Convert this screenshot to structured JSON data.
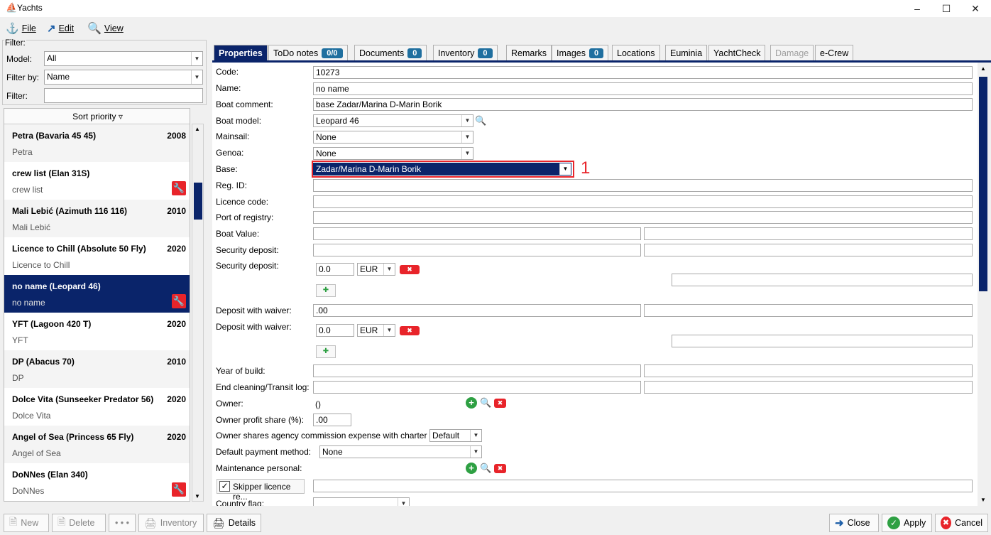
{
  "window": {
    "title": "Yachts"
  },
  "menu": {
    "file": "File",
    "edit": "Edit",
    "view": "View"
  },
  "filter": {
    "legend": "Filter:",
    "model_label": "Model:",
    "model_value": "All",
    "filterby_label": "Filter by:",
    "filterby_value": "Name",
    "filter_label": "Filter:",
    "filter_value": ""
  },
  "list": {
    "sort_header": "Sort priority ▿",
    "items": [
      {
        "name": "Petra (Bavaria 45 45)",
        "year": "2008",
        "sub": "Petra",
        "warn": false
      },
      {
        "name": "crew list (Elan 31S)",
        "year": "",
        "sub": "crew list",
        "warn": true
      },
      {
        "name": "Mali Lebić (Azimuth 116 116)",
        "year": "2010",
        "sub": "Mali Lebić",
        "warn": false
      },
      {
        "name": "Licence to Chill (Absolute 50 Fly)",
        "year": "2020",
        "sub": "Licence to Chill",
        "warn": false
      },
      {
        "name": "no name (Leopard 46)",
        "year": "",
        "sub": "no name",
        "warn": true,
        "selected": true
      },
      {
        "name": "YFT (Lagoon 420 T)",
        "year": "2020",
        "sub": "YFT",
        "warn": false
      },
      {
        "name": "DP (Abacus 70)",
        "year": "2010",
        "sub": "DP",
        "warn": false
      },
      {
        "name": "Dolce Vita (Sunseeker Predator 56)",
        "year": "2020",
        "sub": "Dolce Vita",
        "warn": false
      },
      {
        "name": "Angel of Sea (Princess 65 Fly)",
        "year": "2020",
        "sub": "Angel of Sea",
        "warn": false
      },
      {
        "name": "DoNNes (Elan 340)",
        "year": "",
        "sub": "DoNNes",
        "warn": true
      }
    ]
  },
  "tabs": [
    {
      "label": "Properties",
      "badge": "",
      "state": "active"
    },
    {
      "label": "ToDo notes",
      "badge": "0/0"
    },
    {
      "label": "Documents",
      "badge": "0"
    },
    {
      "label": "Inventory",
      "badge": "0"
    },
    {
      "label": "Remarks",
      "badge": ""
    },
    {
      "label": "Images",
      "badge": "0"
    },
    {
      "label": "Locations",
      "badge": ""
    },
    {
      "label": "Euminia",
      "badge": ""
    },
    {
      "label": "YachtCheck",
      "badge": ""
    },
    {
      "label": "Damage",
      "badge": "",
      "state": "disabled"
    },
    {
      "label": "e-Crew",
      "badge": ""
    }
  ],
  "form": {
    "code_label": "Code:",
    "code_value": "10273",
    "name_label": "Name:",
    "name_value": "no name",
    "comment_label": "Boat comment:",
    "comment_value": "base Zadar/Marina D-Marin Borik",
    "model_label": "Boat model:",
    "model_value": "Leopard 46",
    "mainsail_label": "Mainsail:",
    "mainsail_value": "None",
    "genoa_label": "Genoa:",
    "genoa_value": "None",
    "base_label": "Base:",
    "base_value": "Zadar/Marina D-Marin Borik",
    "annotation": "1",
    "regid_label": "Reg. ID:",
    "licence_label": "Licence code:",
    "port_label": "Port of registry:",
    "value_label": "Boat Value:",
    "secdep_label": "Security deposit:",
    "secdep2_label": "Security deposit:",
    "secdep2_amount": "0.0",
    "secdep2_currency": "EUR",
    "waiver_label": "Deposit with waiver:",
    "waiver_value": ".00",
    "waiver2_label": "Deposit with waiver:",
    "waiver2_amount": "0.0",
    "waiver2_currency": "EUR",
    "year_label": "Year of build:",
    "cleaning_label": "End cleaning/Transit log:",
    "owner_label": "Owner:",
    "owner_value": "()",
    "profit_label": "Owner profit share (%):",
    "profit_value": ".00",
    "commission_label": "Owner shares agency commission expense with charter",
    "commission_value": "Default",
    "payment_label": "Default payment method:",
    "payment_value": "None",
    "maint_label": "Maintenance personal:",
    "skipper_label": "Skipper licence re...",
    "country_label": "Country flag:"
  },
  "buttons": {
    "new": "New",
    "delete": "Delete",
    "dots": "• • •",
    "inventory": "Inventory",
    "details": "Details",
    "close": "Close",
    "apply": "Apply",
    "cancel": "Cancel"
  },
  "colors": {
    "accent": "#0a246a",
    "highlight_box": "#e8242a",
    "badge": "#1f6f9f"
  }
}
